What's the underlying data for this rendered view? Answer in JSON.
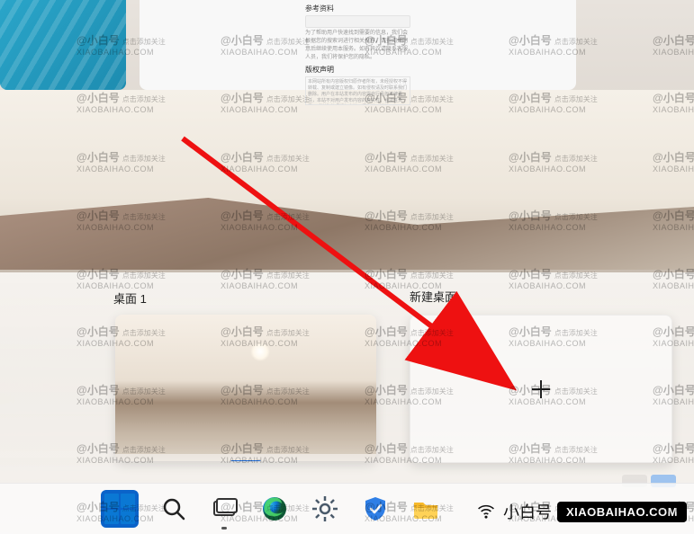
{
  "top_window": {
    "ref_label": "参考资料",
    "notice": "为了帮助用户快速找到需要的信息，我们会根据您的搜索词进行相关推荐，请查阅并同意后继续使用本服务。如有异议请联系客服人员，我们将保护您的隐私。",
    "copyright_label": "版权声明",
    "copyright_text": "本网站所有内容版权归原作者所有，未经授权不得转载、复制或建立镜像。如有侵权请及时联系我们删除。用户在本站发布的内容需自行承担法律责任，本站不对用户发布内容的真实性、合法性负责。感谢您的理解与支持，祝您使用愉快。"
  },
  "desktops": {
    "current_label": "桌面 1",
    "new_label": "新建桌面"
  },
  "watermark": {
    "name": "@小白号",
    "tag": "点击添加关注",
    "domain": "XIAOBAIHAO.COM"
  },
  "badge": {
    "text": "小白号",
    "domain": "XIAOBAIHAO.COM"
  },
  "taskbar": {
    "start": "start-menu",
    "search": "search",
    "taskview": "task-view",
    "edge": "microsoft-edge",
    "settings": "settings",
    "security": "security",
    "explorer": "file-explorer"
  }
}
